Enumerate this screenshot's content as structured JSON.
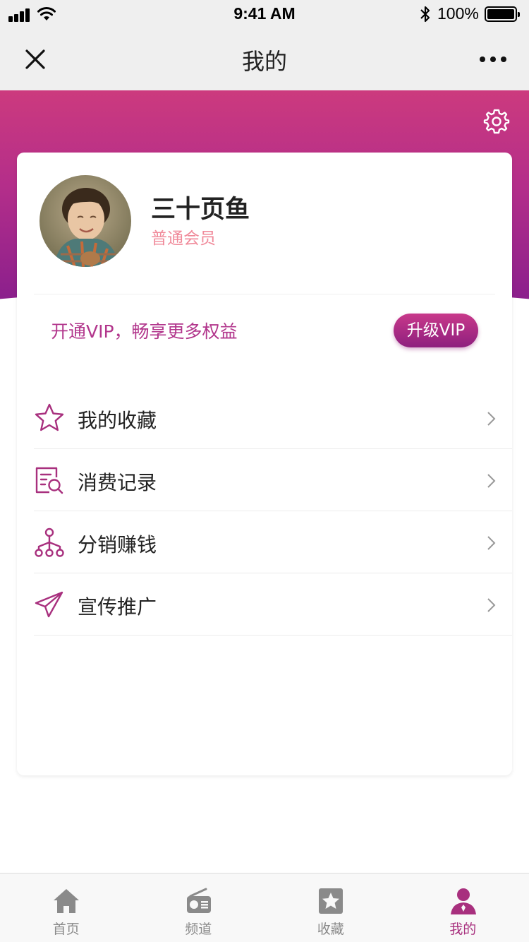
{
  "status_bar": {
    "time": "9:41 AM",
    "battery": "100%",
    "icons": [
      "signal-icon",
      "wifi-icon",
      "bluetooth-icon",
      "battery-icon"
    ]
  },
  "nav": {
    "title": "我的",
    "icons": [
      "close-icon",
      "more-icon"
    ]
  },
  "header": {
    "settings_icon": "gear-icon",
    "accent_top": "#cc3a7e",
    "accent_bottom": "#8a1f8c"
  },
  "profile": {
    "name": "三十页鱼",
    "level": "普通会员"
  },
  "vip": {
    "promo_text": "开通VIP，畅享更多权益",
    "button_label": "升级VIP"
  },
  "menu": {
    "items": [
      {
        "label": "我的收藏",
        "icon": "star-icon"
      },
      {
        "label": "消费记录",
        "icon": "receipt-search-icon"
      },
      {
        "label": "分销赚钱",
        "icon": "network-icon"
      },
      {
        "label": "宣传推广",
        "icon": "paper-plane-icon"
      }
    ]
  },
  "tabs": [
    {
      "label": "首页",
      "icon": "home-icon",
      "active": false
    },
    {
      "label": "频道",
      "icon": "radio-icon",
      "active": false
    },
    {
      "label": "收藏",
      "icon": "star-box-icon",
      "active": false
    },
    {
      "label": "我的",
      "icon": "user-icon",
      "active": true
    }
  ],
  "colors": {
    "accent": "#b2368c",
    "level_text": "#f08a9a",
    "tab_inactive": "#8a8a8a",
    "tab_active": "#a8307e"
  }
}
